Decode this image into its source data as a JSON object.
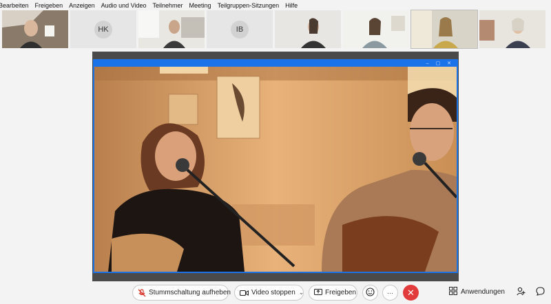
{
  "menu": {
    "items": [
      "Bearbeiten",
      "Freigeben",
      "Anzeigen",
      "Audio und Video",
      "Teilnehmer",
      "Meeting",
      "Teilgruppen-Sitzungen",
      "Hilfe"
    ]
  },
  "participants": [
    {
      "type": "video"
    },
    {
      "type": "avatar",
      "initials": "HK"
    },
    {
      "type": "video"
    },
    {
      "type": "avatar",
      "initials": "IB"
    },
    {
      "type": "video"
    },
    {
      "type": "video"
    },
    {
      "type": "video"
    },
    {
      "type": "video"
    }
  ],
  "controls": {
    "unmute_label": "Stummschaltung aufheben",
    "video_label": "Video stoppen",
    "share_label": "Freigeben",
    "more_label": "···",
    "apps_label": "Anwendungen"
  },
  "icons": {
    "mute": "mic-muted-icon",
    "video": "camera-icon",
    "share": "share-screen-icon",
    "reactions": "emoji-icon",
    "more": "more-icon",
    "end": "end-call-icon",
    "apps": "apps-grid-icon",
    "participants": "participants-icon",
    "chat": "chat-icon"
  },
  "colors": {
    "accent": "#1a73e8",
    "end_call": "#e23b3b",
    "mute_icon": "#d93025"
  }
}
